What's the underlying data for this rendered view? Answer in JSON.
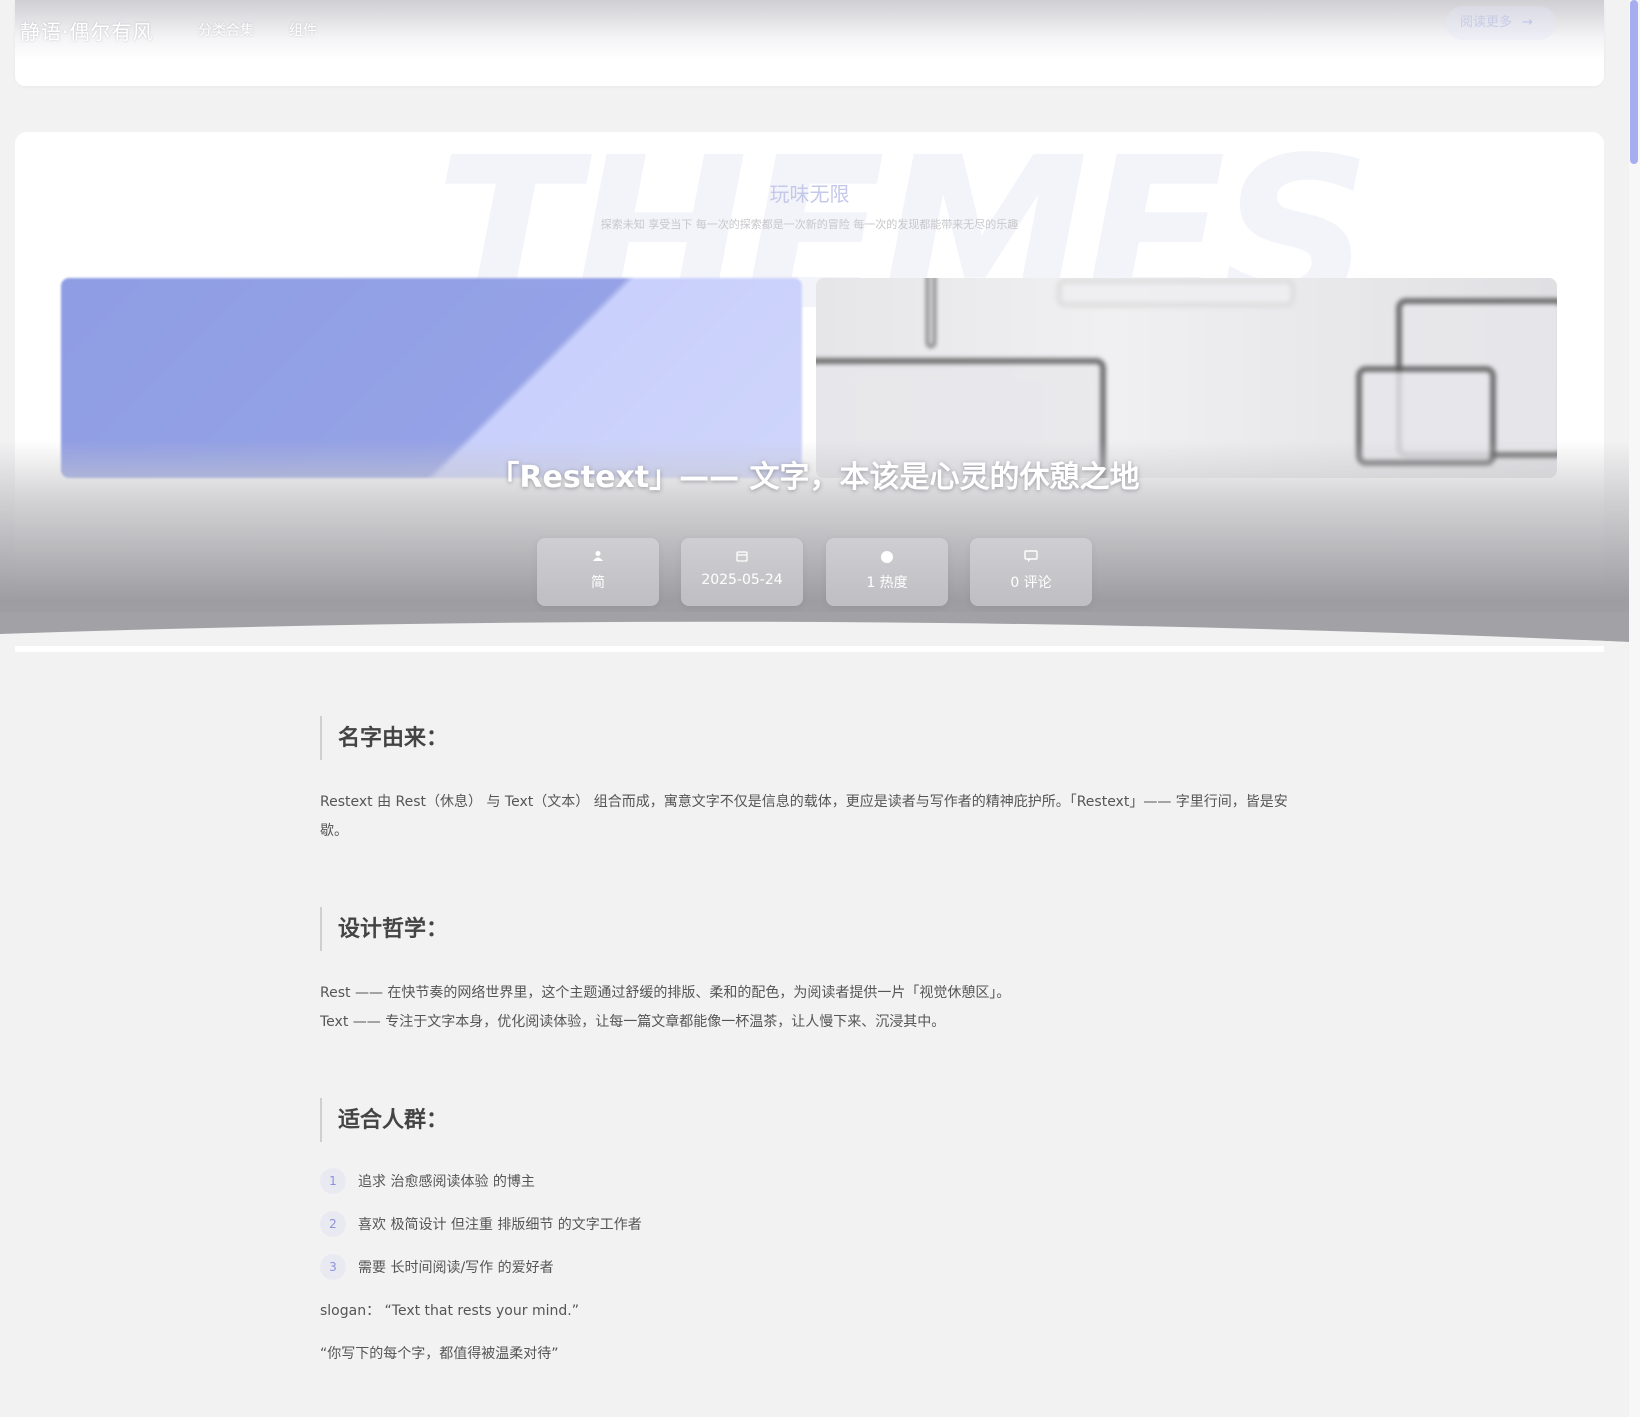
{
  "nav": {
    "logo": "静语·偶尔有风",
    "links": [
      "分类合集",
      "组件"
    ],
    "read_more": "阅读更多",
    "read_more_icon": "arrow-right-icon"
  },
  "hero": {
    "watermark": "THEMES",
    "title": "玩味无限",
    "subtitle": "探索未知 享受当下 每一次的探索都是一次新的冒险 每一次的发现都能带来无尽的乐趣"
  },
  "post": {
    "title": "「Restext」—— 文字，本该是心灵的休憩之地",
    "stats": [
      {
        "icon": "user-icon",
        "text": "简"
      },
      {
        "icon": "calendar-icon",
        "text": "2025-05-24"
      },
      {
        "icon": "flame-icon",
        "text": "1 热度"
      },
      {
        "icon": "comment-icon",
        "text": "0 评论"
      }
    ]
  },
  "article": {
    "section1": {
      "heading": "名字由来：",
      "para": "Restext 由 Rest（休息） 与 Text（文本） 组合而成，寓意文字不仅是信息的载体，更应是读者与写作者的精神庇护所。「Restext」—— 字里行间，皆是安歇。"
    },
    "section2": {
      "heading": "设计哲学：",
      "line1": "Rest —— 在快节奏的网络世界里，这个主题通过舒缓的排版、柔和的配色，为阅读者提供一片「视觉休憩区」。",
      "line2": "Text —— 专注于文字本身，优化阅读体验，让每一篇文章都能像一杯温茶，让人慢下来、沉浸其中。"
    },
    "section3": {
      "heading": "适合人群：",
      "items": [
        {
          "num": "1",
          "text": "追求 治愈感阅读体验 的博主"
        },
        {
          "num": "2",
          "text": "喜欢 极简设计 但注重 排版细节 的文字工作者"
        },
        {
          "num": "3",
          "text": "需要 长时间阅读/写作 的爱好者"
        }
      ],
      "slogan": "slogan： “Text that rests your mind.”",
      "quote": "“你写下的每个字，都值得被温柔对待”"
    }
  },
  "colors": {
    "accent": "#8f9de4",
    "background": "#f2f2f3"
  }
}
